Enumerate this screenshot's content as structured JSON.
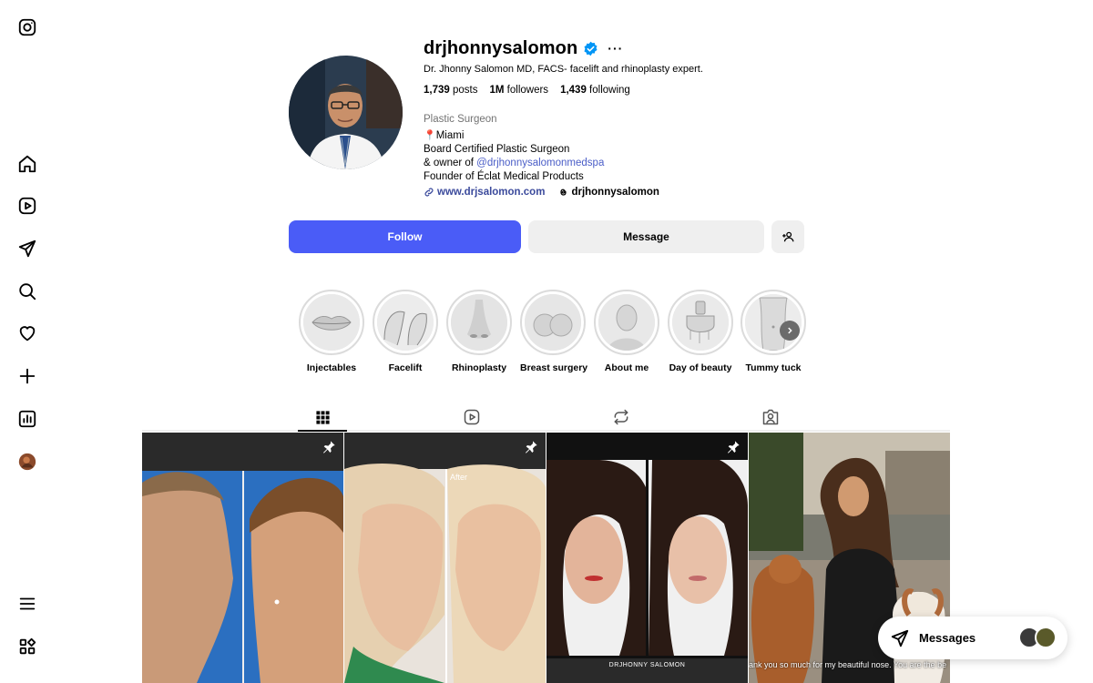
{
  "sidebar": {
    "items": [
      {
        "icon": "instagram-logo-icon"
      },
      {
        "icon": "home-icon"
      },
      {
        "icon": "reels-icon"
      },
      {
        "icon": "send-icon"
      },
      {
        "icon": "search-icon"
      },
      {
        "icon": "heart-icon"
      },
      {
        "icon": "create-plus-icon"
      },
      {
        "icon": "dashboard-icon"
      },
      {
        "icon": "profile-avatar-icon"
      },
      {
        "icon": "menu-icon"
      },
      {
        "icon": "more-apps-icon"
      }
    ]
  },
  "profile": {
    "username": "drjhonnysalomon",
    "more_label": "···",
    "full_name": "Dr. Jhonny Salomon MD, FACS- facelift and rhinoplasty expert.",
    "stats": {
      "posts_count": "1,739",
      "posts_label": "posts",
      "followers_count": "1M",
      "followers_label": "followers",
      "following_count": "1,439",
      "following_label": "following"
    },
    "category": "Plastic Surgeon",
    "bio": {
      "location": "Miami",
      "line2": "Board Certified Plastic Surgeon",
      "line3_prefix": "& owner of ",
      "line3_mention": "@drjhonnysalomonmedspa",
      "line4": "Founder of Éclat Medical Products"
    },
    "website": "www.drjsalomon.com",
    "threads_handle": "drjhonnysalomon"
  },
  "actions": {
    "follow_label": "Follow",
    "message_label": "Message"
  },
  "highlights": [
    {
      "label": "Injectables"
    },
    {
      "label": "Facelift"
    },
    {
      "label": "Rhinoplasty"
    },
    {
      "label": "Breast surgery"
    },
    {
      "label": "About me"
    },
    {
      "label": "Day of beauty"
    },
    {
      "label": "Tummy tuck"
    }
  ],
  "tabs": [
    {
      "icon": "grid-icon",
      "active": true
    },
    {
      "icon": "reels-tab-icon",
      "active": false
    },
    {
      "icon": "reposts-icon",
      "active": false
    },
    {
      "icon": "tagged-icon",
      "active": false
    }
  ],
  "posts": [
    {
      "pinned": true
    },
    {
      "pinned": true,
      "overlay_text": "After"
    },
    {
      "pinned": true,
      "overlay_text": "DRJHONNY SALOMON"
    },
    {
      "pinned": false,
      "overlay_text": "ank you so much for my beautiful nose. You are the be"
    }
  ],
  "messages": {
    "label": "Messages"
  },
  "colors": {
    "accent_blue": "#4a5cf7",
    "verified_blue": "#0095f6",
    "link_blue": "#4a5dc7",
    "secondary_text": "#737373",
    "button_gray": "#efefef"
  }
}
